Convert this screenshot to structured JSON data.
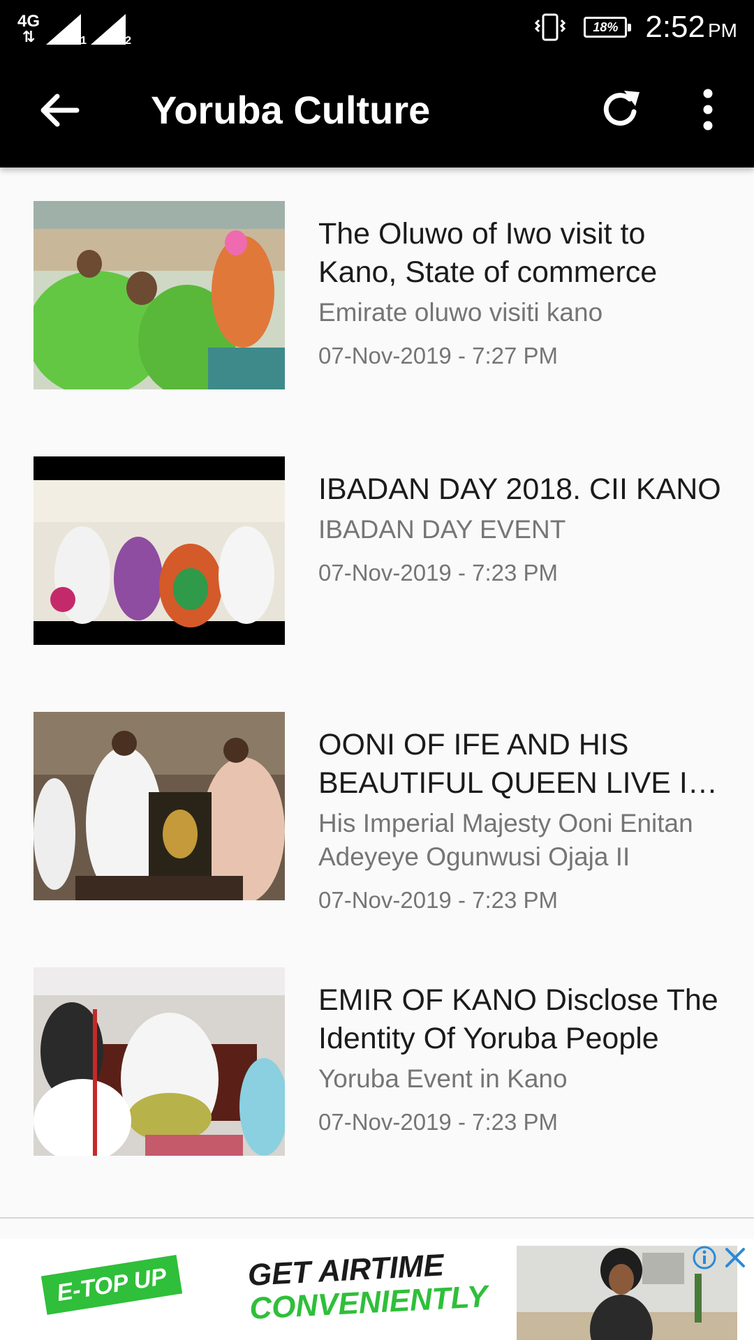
{
  "status_bar": {
    "network": "4G",
    "sim1": "1",
    "sim2": "2",
    "battery": "18%",
    "time": "2:52",
    "ampm": "PM"
  },
  "app_bar": {
    "title": "Yoruba Culture"
  },
  "items": [
    {
      "title": "The Oluwo of Iwo visit to Kano, State of commerce",
      "subtitle": "Emirate oluwo visiti kano",
      "date": "07-Nov-2019 - 7:27 PM"
    },
    {
      "title": "IBADAN DAY 2018. CII KANO",
      "subtitle": "IBADAN DAY EVENT",
      "date": "07-Nov-2019 - 7:23 PM"
    },
    {
      "title": "OONI OF IFE AND HIS BEAUTIFUL QUEEN LIVE IN KANO",
      "subtitle": "His Imperial Majesty Ooni Enitan Adeyeye Ogunwusi Ojaja II",
      "date": "07-Nov-2019 - 7:23 PM"
    },
    {
      "title": "EMIR OF KANO Disclose The Identity Of Yoruba People",
      "subtitle": "Yoruba Event in Kano",
      "date": "07-Nov-2019 - 7:23 PM"
    }
  ],
  "ad": {
    "tag": "E-TOP UP",
    "headline_1": "GET AIRTIME",
    "headline_2": "CONVENIENTLY"
  }
}
